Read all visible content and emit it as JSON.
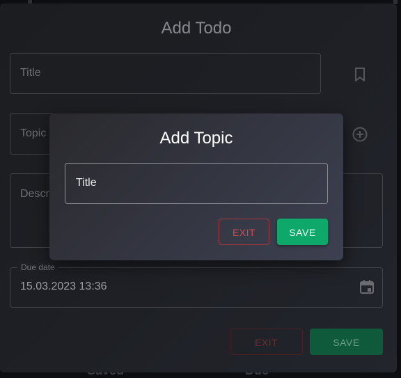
{
  "background": {
    "bottom_left_text": "Saved",
    "bottom_right_text": "Due"
  },
  "todo_dialog": {
    "title": "Add Todo",
    "title_field": {
      "placeholder": "Title",
      "icon": "bookmark-icon"
    },
    "topic_field": {
      "placeholder": "Topic",
      "icon": "add-circle-icon"
    },
    "description_field": {
      "placeholder": "Description"
    },
    "due_date": {
      "label": "Due date",
      "value": "15.03.2023 13:36",
      "icon": "calendar-icon"
    },
    "exit_label": "EXIT",
    "save_label": "SAVE"
  },
  "topic_dialog": {
    "title": "Add Topic",
    "title_field": {
      "placeholder": "Title"
    },
    "exit_label": "EXIT",
    "save_label": "SAVE"
  },
  "colors": {
    "save_green": "#0ea86a",
    "exit_red": "#d24a4e",
    "dialog_background": "#1d1f24"
  }
}
